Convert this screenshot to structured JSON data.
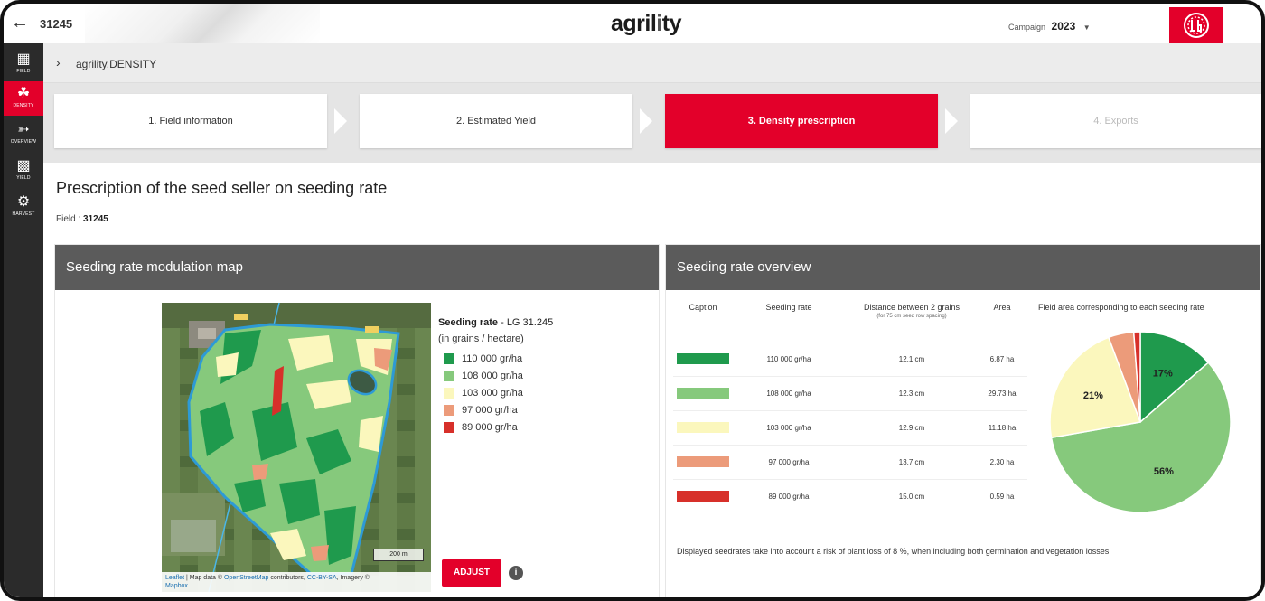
{
  "header": {
    "back_icon": "arrow-left-icon",
    "field_id": "31245",
    "logo_pre": "agril",
    "logo_i": "i",
    "logo_post": "ty",
    "campaign_label": "Campaign",
    "campaign_value": "2023",
    "brand_icon": "brand-logo-icon",
    "brand_color": "#e3002a"
  },
  "sidebar": {
    "items": [
      {
        "label": "FIELD",
        "icon": "field-grid-icon"
      },
      {
        "label": "DENSITY",
        "icon": "seeding-icon"
      },
      {
        "label": "OVERVIEW",
        "icon": "overview-icon"
      },
      {
        "label": "YIELD",
        "icon": "yield-icon"
      },
      {
        "label": "HARVEST",
        "icon": "harvest-icon"
      }
    ]
  },
  "breadcrumb": {
    "icon": "chevron-right-icon",
    "text": "agrility.DENSITY"
  },
  "steps": [
    {
      "label": "1. Field information",
      "state": "done"
    },
    {
      "label": "2. Estimated Yield",
      "state": "done"
    },
    {
      "label": "3. Density prescription",
      "state": "active"
    },
    {
      "label": "4. Exports",
      "state": "disabled"
    }
  ],
  "page": {
    "title": "Prescription of the seed seller on seeding rate",
    "field_label": "Field :",
    "field_value": "31245"
  },
  "map_panel": {
    "title": "Seeding rate modulation map",
    "legend_title": "Seeding rate",
    "legend_title_suffix": "- LG 31.245",
    "legend_sub": "(in grains / hectare)",
    "legend": [
      {
        "label": "110 000 gr/ha",
        "color": "#1f9a4d"
      },
      {
        "label": "108 000 gr/ha",
        "color": "#86c97c"
      },
      {
        "label": "103 000 gr/ha",
        "color": "#fbf7bd"
      },
      {
        "label": "97 000 gr/ha",
        "color": "#ec9b7a"
      },
      {
        "label": "89 000 gr/ha",
        "color": "#d7302a"
      }
    ],
    "scale_label": "200 m",
    "attribution_1": "Leaflet",
    "attribution_2": " | Map data © ",
    "attribution_3": "OpenStreetMap",
    "attribution_4": " contributors, ",
    "attribution_5": "CC-BY-SA",
    "attribution_6": ", Imagery ©",
    "attribution_7": "Mapbox",
    "adjust_label": "ADJUST",
    "info_icon": "info-circle-icon",
    "info_glyph": "i"
  },
  "overview_panel": {
    "title": "Seeding rate overview",
    "headers": {
      "caption": "Caption",
      "rate": "Seeding rate",
      "distance": "Distance between 2 grains",
      "distance_sub": "(for 75 cm seed row spacing)",
      "area": "Area"
    },
    "rows": [
      {
        "color": "#1f9a4d",
        "rate": "110 000 gr/ha",
        "distance": "12.1 cm",
        "area": "6.87 ha"
      },
      {
        "color": "#86c97c",
        "rate": "108 000 gr/ha",
        "distance": "12.3 cm",
        "area": "29.73 ha"
      },
      {
        "color": "#fbf7bd",
        "rate": "103 000 gr/ha",
        "distance": "12.9 cm",
        "area": "11.18 ha"
      },
      {
        "color": "#ec9b7a",
        "rate": "97 000 gr/ha",
        "distance": "13.7 cm",
        "area": "2.30 ha"
      },
      {
        "color": "#d7302a",
        "rate": "89 000 gr/ha",
        "distance": "15.0 cm",
        "area": "0.59 ha"
      }
    ],
    "pie_title": "Field area corresponding to each seeding rate",
    "footnote": "Displayed seedrates take into account a risk of plant loss of 8 %, when including both germination and vegetation losses."
  },
  "chart_data": {
    "type": "pie",
    "title": "Field area corresponding to each seeding rate",
    "categories": [
      "110 000 gr/ha",
      "108 000 gr/ha",
      "103 000 gr/ha",
      "97 000 gr/ha",
      "89 000 gr/ha"
    ],
    "values": [
      6.87,
      29.73,
      11.18,
      2.3,
      0.59
    ],
    "colors": [
      "#1f9a4d",
      "#86c97c",
      "#fbf7bd",
      "#ec9b7a",
      "#d7302a"
    ],
    "data_labels": [
      "17%",
      "56%",
      "21%",
      "",
      ""
    ]
  }
}
